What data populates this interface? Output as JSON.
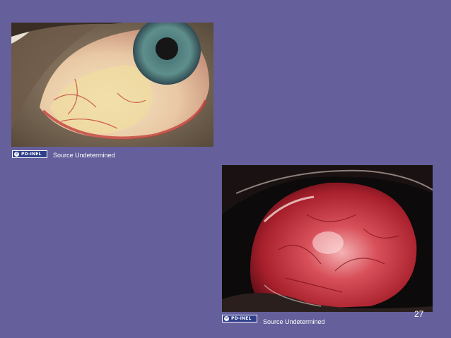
{
  "slide": {
    "background_color": "#655f9b",
    "page_number": "27"
  },
  "images": [
    {
      "description_name": "eye-pinguecula-photo",
      "license_badge": {
        "icon": "public-domain-icon",
        "text": "PD-INEL"
      },
      "source_text": "Source Undetermined"
    },
    {
      "description_name": "eye-conjunctiva-inflamed-photo",
      "license_badge": {
        "icon": "public-domain-icon",
        "text": "PD-INEL"
      },
      "source_text": "Source Undetermined"
    }
  ]
}
